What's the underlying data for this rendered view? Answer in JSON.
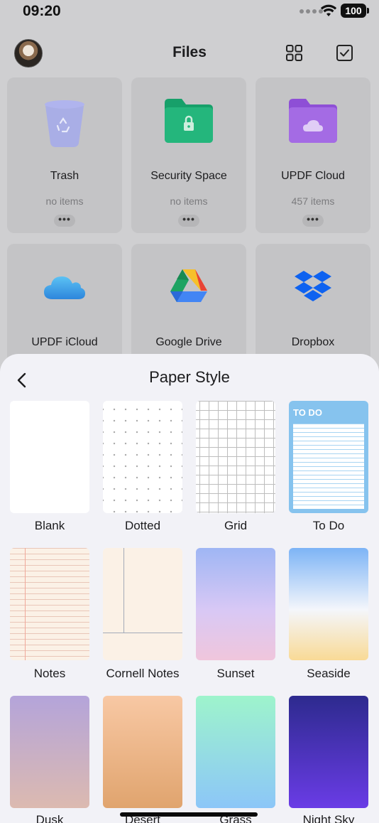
{
  "status_bar": {
    "time": "09:20",
    "battery": "100"
  },
  "header": {
    "title": "Files"
  },
  "file_tiles": [
    {
      "name": "Trash",
      "count": "no items",
      "more": "•••"
    },
    {
      "name": "Security Space",
      "count": "no items",
      "more": "•••"
    },
    {
      "name": "UPDF Cloud",
      "count": "457 items",
      "more": "•••"
    },
    {
      "name": "UPDF iCloud"
    },
    {
      "name": "Google Drive"
    },
    {
      "name": "Dropbox"
    }
  ],
  "sheet": {
    "title": "Paper Style",
    "papers": [
      {
        "label": "Blank"
      },
      {
        "label": "Dotted"
      },
      {
        "label": "Grid"
      },
      {
        "label": "To Do",
        "header_text": "TO DO"
      },
      {
        "label": "Notes"
      },
      {
        "label": "Cornell Notes"
      },
      {
        "label": "Sunset"
      },
      {
        "label": "Seaside"
      },
      {
        "label": "Dusk"
      },
      {
        "label": "Desert"
      },
      {
        "label": "Grass"
      },
      {
        "label": "Night Sky"
      }
    ]
  },
  "icons": {
    "trash": "trash-bin-icon",
    "security": "locked-folder-icon",
    "cloud": "cloud-folder-icon",
    "icloud": "icloud-icon",
    "google_drive": "google-drive-icon",
    "dropbox": "dropbox-icon"
  }
}
